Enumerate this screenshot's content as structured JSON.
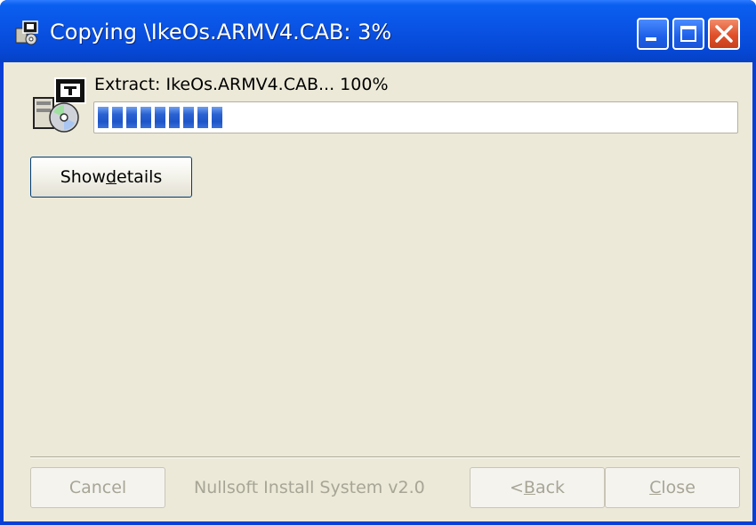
{
  "window": {
    "title": "Copying \\IkeOs.ARMV4.CAB: 3%",
    "icon": "installer-icon"
  },
  "status": {
    "text": "Extract: IkeOs.ARMV4.CAB... 100%"
  },
  "progress": {
    "percent": 21
  },
  "buttons": {
    "details": {
      "before": "Show ",
      "mnemonic": "d",
      "after": "etails"
    },
    "cancel": "Cancel",
    "back": {
      "before": "< ",
      "mnemonic": "B",
      "after": "ack"
    },
    "close": {
      "before": "",
      "mnemonic": "C",
      "after": "lose"
    }
  },
  "branding": "Nullsoft Install System v2.0",
  "colors": {
    "titlebar": "#0a53e4",
    "client": "#ece9d8",
    "progress_fill": "#2b62d2",
    "close_button": "#e0502a"
  }
}
